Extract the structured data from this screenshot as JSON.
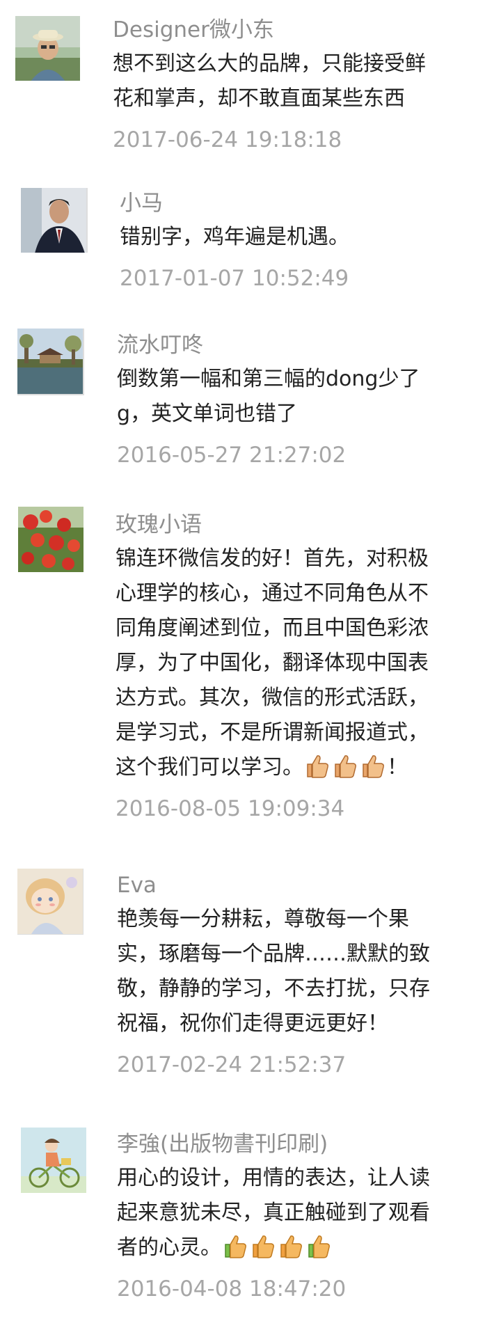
{
  "comments": [
    {
      "name": "Designer微小东",
      "lines": [
        "想不到这么大的品牌，只能接受鲜",
        "花和掌声，却不敢直面某些东西"
      ],
      "time": "2017-06-24 19:18:18",
      "avatar": "person-in-hat-avatar"
    },
    {
      "name": "小马",
      "lines": [
        "错别字，鸡年遍是机遇。"
      ],
      "time": "2017-01-07 10:52:49",
      "avatar": "man-in-suit-avatar"
    },
    {
      "name": "流水叮咚",
      "lines": [
        "倒数第一幅和第三幅的dong少了",
        "g，英文单词也错了"
      ],
      "time": "2016-05-27 21:27:02",
      "avatar": "pavilion-lake-avatar"
    },
    {
      "name": "玫瑰小语",
      "lines": [
        "锦连环微信发的好！首先，对积极",
        "心理学的核心，通过不同角色从不",
        "同角度阐述到位，而且中国色彩浓",
        "厚，为了中国化，翻译体现中国表",
        "达方式。其次，微信的形式活跃，",
        "是学习式，不是所谓新闻报道式，",
        "这个我们可以学习。"
      ],
      "trailing": "！",
      "thumbs": 3,
      "time": "2016-08-05 19:09:34",
      "avatar": "red-fruit-tree-avatar"
    },
    {
      "name": "Eva",
      "lines": [
        "艳羡每一分耕耘，尊敬每一个果",
        "实，琢磨每一个品牌……默默的致",
        "敬，静静的学习，不去打扰，只存",
        "祝福，祝你们走得更远更好！"
      ],
      "time": "2017-02-24 21:52:37",
      "avatar": "cartoon-girl-avatar"
    },
    {
      "name": "李強(出版物書刊印刷)",
      "lines": [
        "用心的设计，用情的表达，让人读",
        "起来意犹未尽，真正触碰到了观看",
        "者的心灵。"
      ],
      "thumbs": 4,
      "time": "2016-04-08 18:47:20",
      "avatar": "bicycle-girl-avatar"
    }
  ]
}
